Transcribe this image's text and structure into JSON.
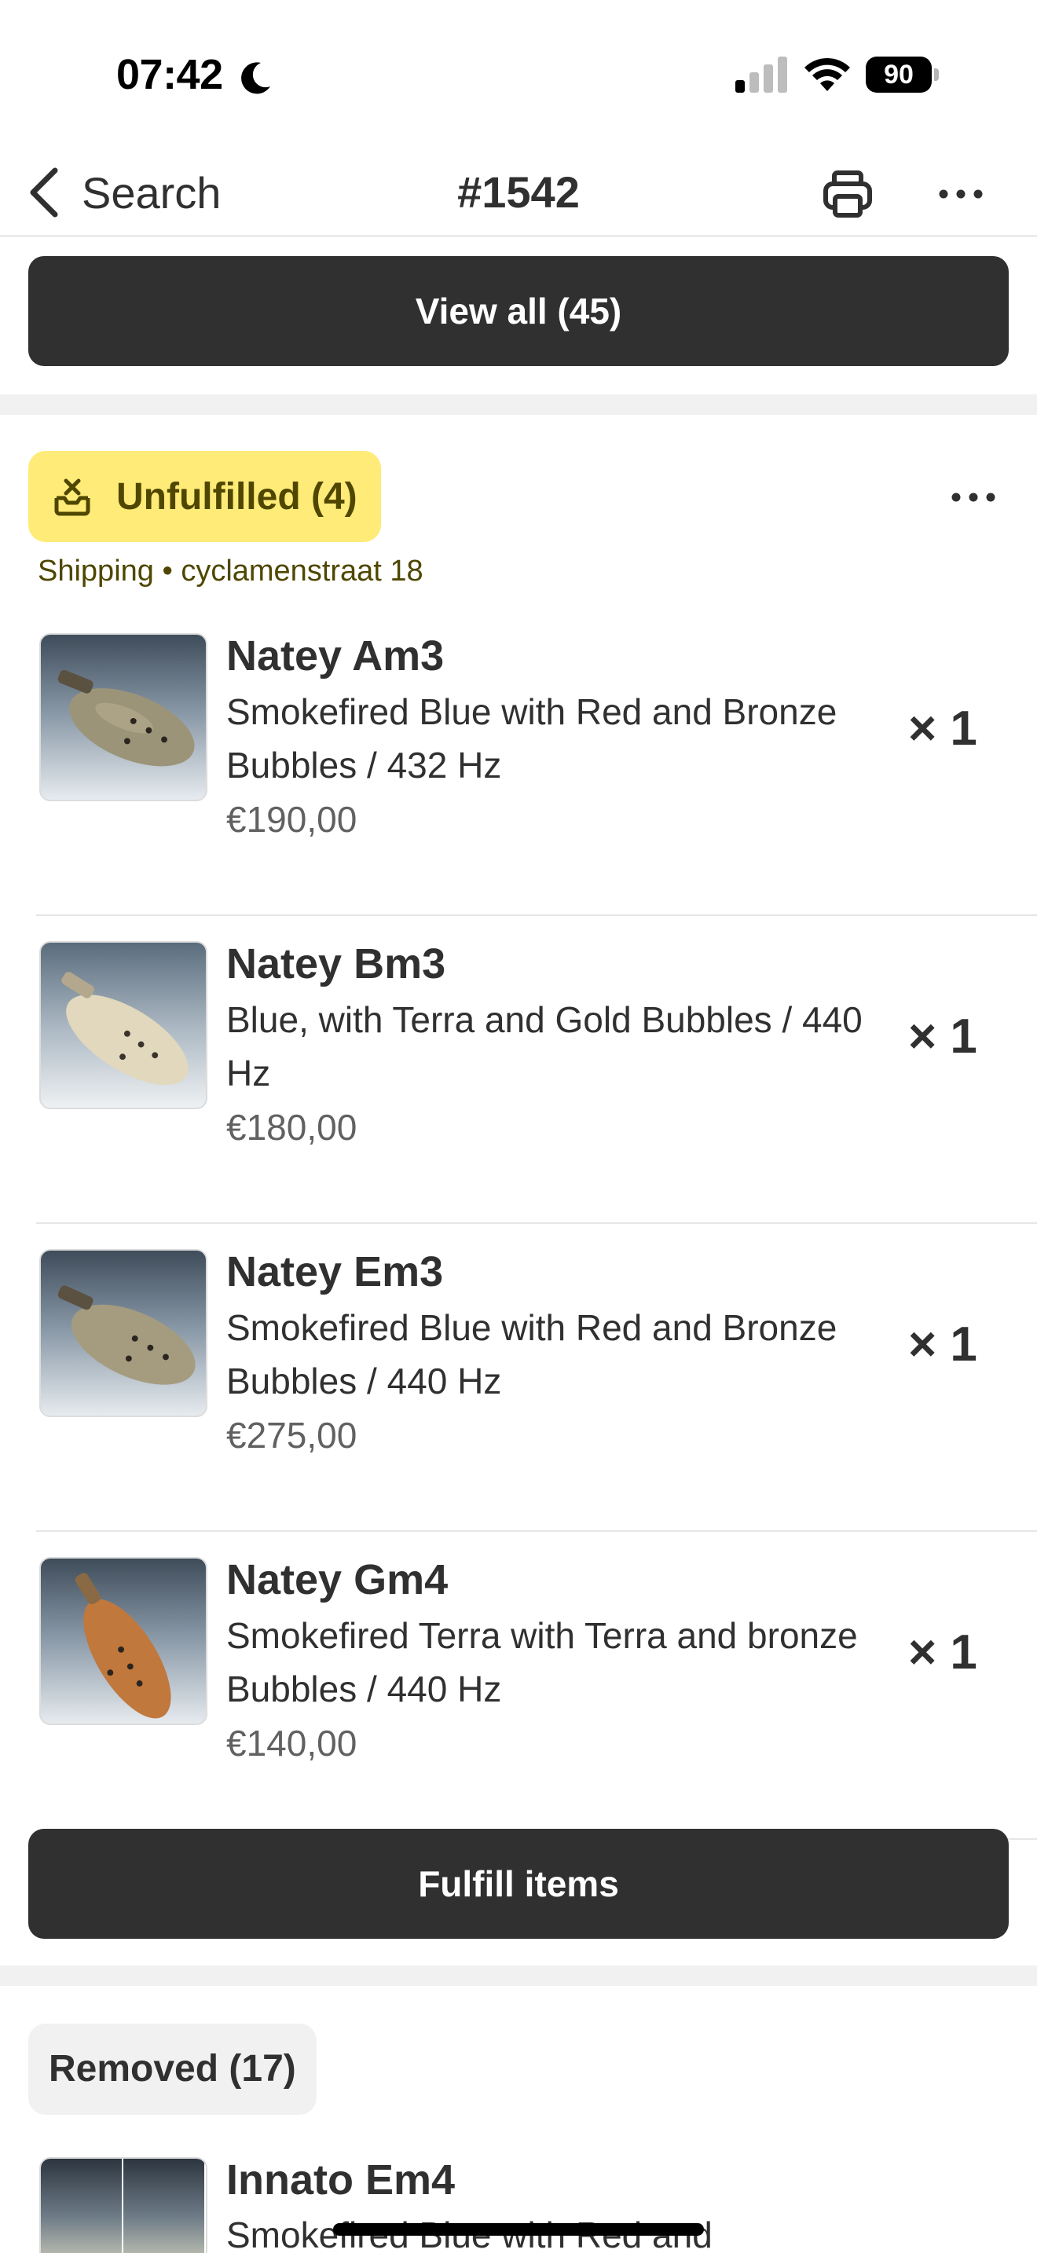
{
  "status_bar": {
    "time": "07:42",
    "battery": "90"
  },
  "nav": {
    "back_label": "Search",
    "title": "#1542"
  },
  "view_all_label": "View all (45)",
  "unfulfilled": {
    "badge": "Unfulfilled (4)",
    "shipping": "Shipping • cyclamenstraat 18",
    "items": [
      {
        "name": "Natey Am3",
        "variant": "Smokefired Blue with Red and Bronze Bubbles / 432 Hz",
        "price": "€190,00",
        "qty": "× 1"
      },
      {
        "name": "Natey Bm3",
        "variant": "Blue, with Terra and Gold Bubbles / 440 Hz",
        "price": "€180,00",
        "qty": "× 1"
      },
      {
        "name": "Natey Em3",
        "variant": "Smokefired Blue with Red and Bronze Bubbles / 440 Hz",
        "price": "€275,00",
        "qty": "× 1"
      },
      {
        "name": "Natey Gm4",
        "variant": "Smokefired Terra with Terra and bronze Bubbles / 440 Hz",
        "price": "€140,00",
        "qty": "× 1"
      }
    ],
    "fulfill_label": "Fulfill items"
  },
  "removed": {
    "badge": "Removed (17)",
    "items": [
      {
        "name": "Innato Em4",
        "variant": "Smokefired Blue with Red and"
      }
    ]
  },
  "colors": {
    "button_dark": "#303030",
    "unfulfilled_badge": "#ffeb78",
    "unfulfilled_text": "#4f4700",
    "separator": "#f1f1f1"
  },
  "icons": [
    "moon-icon",
    "cellular-signal-icon",
    "wifi-icon",
    "battery-icon",
    "chevron-left-icon",
    "printer-icon",
    "more-horizontal-icon",
    "unfulfilled-icon"
  ]
}
